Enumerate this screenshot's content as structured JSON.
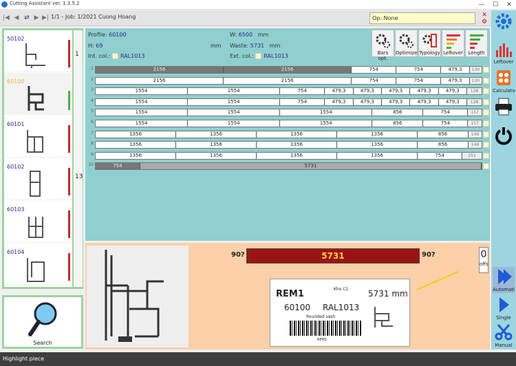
{
  "window": {
    "title": "Cutting Assistant ver. 1.3.5.2",
    "controls": [
      "—",
      "☐",
      "✕"
    ]
  },
  "toolbar": {
    "nav_first": "|◀",
    "nav_prev": "◀",
    "nav_swap": "⇄",
    "nav_next": "▶",
    "nav_last": "▶|",
    "job": "1/1 - Job: 1/2021 Cuong Hoang",
    "op_label": "Op:",
    "op_value": "None"
  },
  "profiles": [
    {
      "code": "50102",
      "count_label": "1"
    },
    {
      "code": "60100",
      "selected": true
    },
    {
      "code": "60101"
    },
    {
      "code": "60102",
      "count_label": "13"
    },
    {
      "code": "60103"
    },
    {
      "code": "60104"
    }
  ],
  "search": {
    "label": "Search"
  },
  "header": {
    "profile_label": "Profile:",
    "profile": "60100",
    "h_label": "H:",
    "h": "69",
    "h_unit": "mm",
    "w_label": "W:",
    "w": "6500",
    "w_unit": "mm",
    "waste_label": "Waste:",
    "waste": "5731",
    "waste_unit": "mm",
    "int_col_label": "Int. col.:",
    "int_col": "RAL1013",
    "ext_col_label": "Ext. col.:",
    "ext_col": "RAL1013"
  },
  "tools": [
    {
      "label": "Bars opt.",
      "icon": "gears-icon"
    },
    {
      "label": "Optimize",
      "icon": "gears-icon"
    },
    {
      "label": "Typology",
      "icon": "typology-icon"
    },
    {
      "label": "Leftover",
      "icon": "leftover-bars-icon"
    },
    {
      "label": "Length",
      "icon": "length-bars-icon"
    }
  ],
  "bars": [
    {
      "n": "1",
      "cuts": [
        {
          "v": "2156",
          "w": 2156,
          "s": "dark"
        },
        {
          "v": "2156",
          "w": 2156,
          "s": "dark"
        },
        {
          "v": "754",
          "w": 754
        },
        {
          "v": "754",
          "w": 754
        },
        {
          "v": "479,3",
          "w": 479
        }
      ],
      "waste": "130"
    },
    {
      "n": "2",
      "cuts": [
        {
          "v": "2156",
          "w": 2156
        },
        {
          "v": "2156",
          "w": 2156
        },
        {
          "v": "754",
          "w": 754
        },
        {
          "v": "754",
          "w": 754
        },
        {
          "v": "479,3",
          "w": 479
        }
      ],
      "waste": "130"
    },
    {
      "n": "3",
      "cuts": [
        {
          "v": "1554",
          "w": 1554
        },
        {
          "v": "1554",
          "w": 1554
        },
        {
          "v": "754",
          "w": 754
        },
        {
          "v": "479,3",
          "w": 479
        },
        {
          "v": "479,3",
          "w": 479
        },
        {
          "v": "479,3",
          "w": 479
        },
        {
          "v": "479,3",
          "w": 479
        },
        {
          "v": "479,3",
          "w": 479
        }
      ],
      "waste": "128"
    },
    {
      "n": "4",
      "cuts": [
        {
          "v": "1554",
          "w": 1554
        },
        {
          "v": "1554",
          "w": 1554
        },
        {
          "v": "754",
          "w": 754
        },
        {
          "v": "479,3",
          "w": 479
        },
        {
          "v": "479,3",
          "w": 479
        },
        {
          "v": "479,3",
          "w": 479
        },
        {
          "v": "479,3",
          "w": 479
        },
        {
          "v": "479,3",
          "w": 479
        }
      ],
      "waste": "128"
    },
    {
      "n": "5",
      "cuts": [
        {
          "v": "1554",
          "w": 1554
        },
        {
          "v": "1554",
          "w": 1554
        },
        {
          "v": "1554",
          "w": 1554
        },
        {
          "v": "856",
          "w": 856
        },
        {
          "v": "754",
          "w": 754
        }
      ],
      "waste": "157"
    },
    {
      "n": "6",
      "cuts": [
        {
          "v": "1554",
          "w": 1554
        },
        {
          "v": "1554",
          "w": 1554
        },
        {
          "v": "1554",
          "w": 1554
        },
        {
          "v": "856",
          "w": 856
        },
        {
          "v": "754",
          "w": 754
        }
      ],
      "waste": "157"
    },
    {
      "n": "7",
      "cuts": [
        {
          "v": "1356",
          "w": 1356
        },
        {
          "v": "1356",
          "w": 1356
        },
        {
          "v": "1356",
          "w": 1356
        },
        {
          "v": "1356",
          "w": 1356
        },
        {
          "v": "856",
          "w": 856
        }
      ],
      "waste": "149"
    },
    {
      "n": "8",
      "cuts": [
        {
          "v": "1356",
          "w": 1356
        },
        {
          "v": "1356",
          "w": 1356
        },
        {
          "v": "1356",
          "w": 1356
        },
        {
          "v": "1356",
          "w": 1356
        },
        {
          "v": "856",
          "w": 856
        }
      ],
      "waste": "149"
    },
    {
      "n": "9",
      "cuts": [
        {
          "v": "1356",
          "w": 1356
        },
        {
          "v": "1356",
          "w": 1356
        },
        {
          "v": "1356",
          "w": 1356
        },
        {
          "v": "1356",
          "w": 1356
        },
        {
          "v": "754",
          "w": 754
        }
      ],
      "waste": "251"
    },
    {
      "n": "10",
      "cuts": [
        {
          "v": "754",
          "w": 754,
          "s": "dark"
        },
        {
          "v": "5731",
          "w": 5746,
          "s": "grey"
        }
      ],
      "waste": ""
    }
  ],
  "current_cut": {
    "angle_left": "90?",
    "angle_right": "90?",
    "length": "5731",
    "offs_count": "0",
    "offs_label": "offs"
  },
  "label_card": {
    "title": "REM1",
    "store": "Kho C1",
    "length": "5731 mm",
    "profile": "60100",
    "color": "RAL1013",
    "desc": "Rounded sash",
    "barcode_text": "REM1"
  },
  "right_buttons": [
    {
      "label": "",
      "icon": "gear-icon"
    },
    {
      "label": "Leftover",
      "icon": "leftover-icon"
    },
    {
      "label": "Calculato",
      "icon": "calculator-icon"
    },
    {
      "label": "",
      "icon": "printer-icon"
    },
    {
      "label": "",
      "icon": "power-icon"
    },
    {
      "label": "Automati",
      "icon": "play-fast-icon"
    },
    {
      "label": "Single",
      "icon": "play-icon"
    },
    {
      "label": "Manual",
      "icon": "scissors-icon"
    }
  ],
  "status": {
    "text": "Highlight piece"
  },
  "colors": {
    "accent_green": "#9fd39f",
    "main_teal": "#8fcfcf",
    "bottom_peach": "#fcd0a8",
    "cut_red": "#9b1414"
  }
}
